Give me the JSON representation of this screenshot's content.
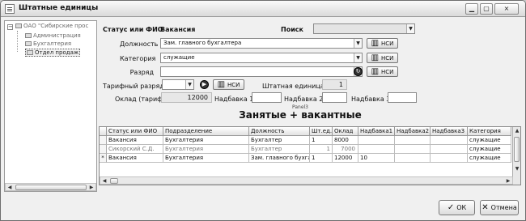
{
  "window": {
    "title": "Штатные единицы",
    "minimize": "▭",
    "maximize": "▭",
    "close": "×"
  },
  "tree": {
    "root": "ОАО \"Сибирские прос",
    "items": [
      "Администрация",
      "Бухгалтерия",
      "Отдел продаж"
    ]
  },
  "form": {
    "status_label": "Статус или ФИО",
    "status_value": "Вакансия",
    "search_label": "Поиск",
    "position_label": "Должность",
    "position_value": "Зам. главного бухгалтера",
    "category_label": "Категория",
    "category_value": "служащие",
    "grade_label": "Разряд",
    "grade_value": "",
    "tariff_label": "Тарифный разряд",
    "tariff_value": "",
    "unit_label": "Штатная единица",
    "unit_value": "1",
    "salary_label": "Оклад (тариф)",
    "salary_value": "12000",
    "bonus1_label": "Надбавка 1",
    "bonus2_label": "Надбавка 2",
    "bonus3_label": "Надбавка 3",
    "panel_hint": "Panel3",
    "nsi_label": "НСИ",
    "grid_title": "Занятые + вакантные"
  },
  "table": {
    "columns": [
      "Статус или ФИО",
      "Подразделение",
      "Должность",
      "Шт.ед.",
      "Оклад",
      "Надбавка1",
      "Надбавка2",
      "Надбавка3",
      "Категория"
    ],
    "rows": [
      [
        "Вакансия",
        "Бухгалтерия",
        "Бухгалтер",
        "1",
        "8000",
        "",
        "",
        "",
        "служащие"
      ],
      [
        "Сикорский С.Д.",
        "Бухгалтерия",
        "Бухгалтер",
        "1",
        "7000",
        "",
        "",
        "",
        "служащие"
      ],
      [
        "Вакансия",
        "Бухгалтерия",
        "Зам. главного бухгалтера",
        "1",
        "12000",
        "10",
        "",
        "",
        "служащие"
      ]
    ],
    "current_row_marker": "*"
  },
  "buttons": {
    "ok": "ОК",
    "cancel": "Отмена"
  },
  "icons": [
    "app-icon",
    "tree-folder-icon",
    "book-icon",
    "arrow-circle-icon",
    "dropdown-arrow-icon",
    "ok-check-icon",
    "cancel-icon"
  ]
}
